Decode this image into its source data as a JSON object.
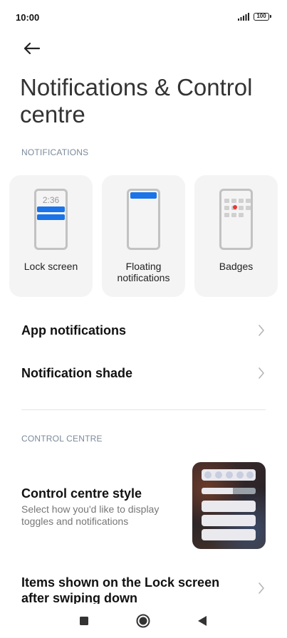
{
  "status": {
    "time": "10:00",
    "battery": "100"
  },
  "header": {
    "title": "Notifications & Control centre"
  },
  "notifications": {
    "section_label": "NOTIFICATIONS",
    "cards": [
      {
        "label": "Lock screen",
        "preview_time": "2:36"
      },
      {
        "label": "Floating notifications"
      },
      {
        "label": "Badges"
      }
    ],
    "rows": [
      {
        "label": "App notifications"
      },
      {
        "label": "Notification shade"
      }
    ]
  },
  "control_centre": {
    "section_label": "CONTROL CENTRE",
    "style_title": "Control centre style",
    "style_subtitle": "Select how you'd like to display toggles and notifications",
    "items_row_label": "Items shown on the Lock screen after swiping down"
  },
  "colors": {
    "accent": "#1a73e8",
    "badge_dot": "#e53935",
    "section_header": "#7a8a9a"
  },
  "icons": [
    "back-arrow-icon",
    "signal-icon",
    "battery-icon",
    "chevron-right-icon",
    "recents-icon",
    "home-icon",
    "back-icon"
  ]
}
